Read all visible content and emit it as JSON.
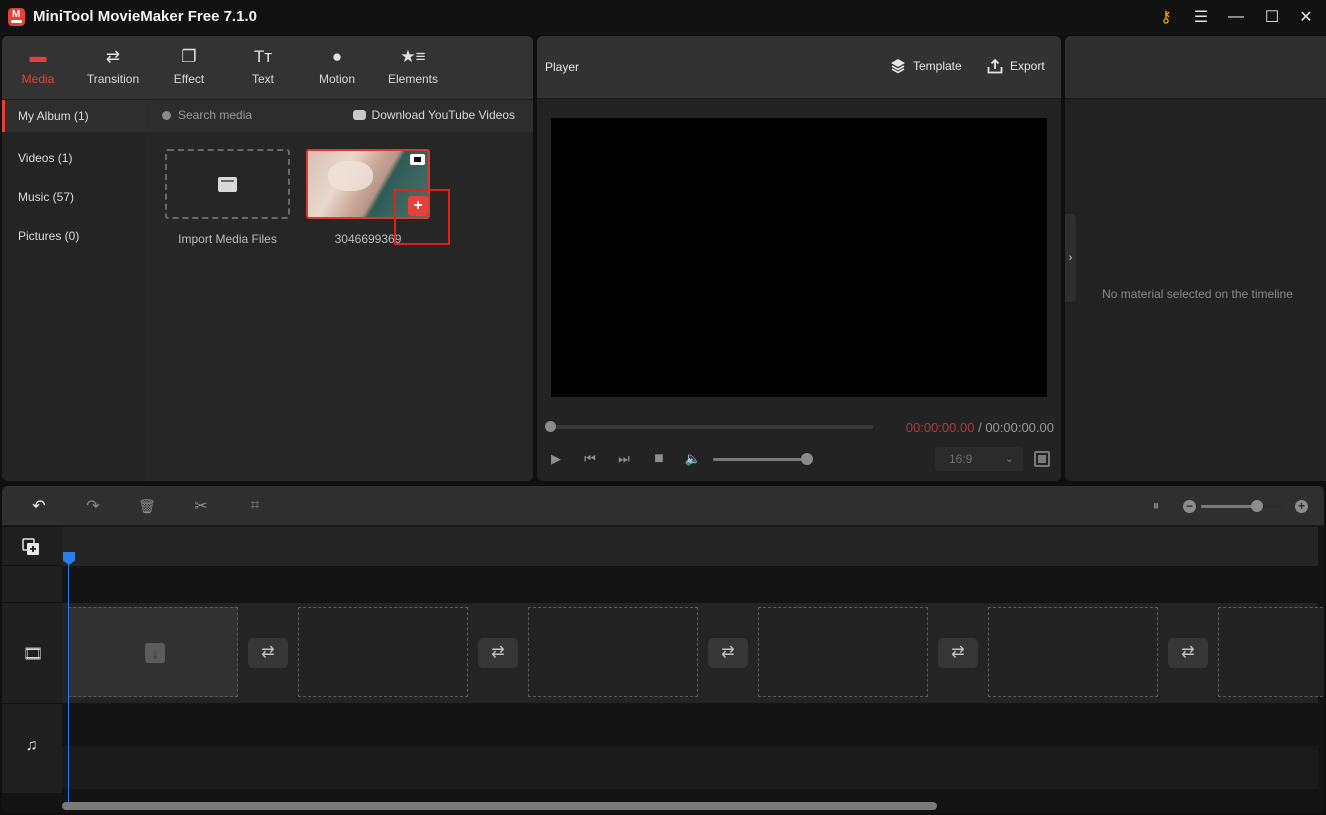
{
  "window": {
    "title": "MiniTool MovieMaker Free 7.1.0",
    "logo_glyph": "M",
    "controls": {
      "key": "⚷",
      "menu": "☰",
      "minimize": "—",
      "maximize": "☐",
      "close": "✕"
    }
  },
  "toolbar": {
    "tabs": [
      {
        "label": "Media",
        "icon": "▬",
        "active": true
      },
      {
        "label": "Transition",
        "icon": "⇄"
      },
      {
        "label": "Effect",
        "icon": "❐"
      },
      {
        "label": "Text",
        "icon": "Tт"
      },
      {
        "label": "Motion",
        "icon": "●"
      },
      {
        "label": "Elements",
        "icon": "★≡"
      }
    ]
  },
  "sidebar": {
    "items": [
      {
        "label": "My Album (1)",
        "active": true
      },
      {
        "label": "Videos (1)"
      },
      {
        "label": "Music (57)"
      },
      {
        "label": "Pictures (0)"
      }
    ]
  },
  "media": {
    "search_placeholder": "Search media",
    "download_label": "Download YouTube Videos",
    "import_label": "Import Media Files",
    "items": [
      {
        "name": "3046699369",
        "type": "video",
        "add_glyph": "+"
      }
    ]
  },
  "player": {
    "title": "Player",
    "template_label": "Template",
    "export_label": "Export",
    "time_current": "00:00:00.00",
    "time_separator": " / ",
    "time_total": "00:00:00.00",
    "progress": 0,
    "volume": 1.0,
    "aspect_ratio": "16:9",
    "controls": {
      "play": "▶",
      "prev": "⏮",
      "next": "⏭",
      "stop": "■",
      "volume": "🔈",
      "chevron": "⌄"
    }
  },
  "properties": {
    "empty_message": "No material selected on the timeline",
    "collapse_glyph": "›"
  },
  "timeline": {
    "toolbar": {
      "undo": "↶",
      "redo": "↷",
      "delete": "🗑",
      "split": "✂",
      "crop": "⌗",
      "fit": "⏸"
    },
    "zoom_level": 0.82,
    "zoom_minus": "−",
    "zoom_plus": "+",
    "video_slots": 6,
    "transition_glyph": "⇄",
    "import_slot_glyph": "↓",
    "track_icons": {
      "add_track": "⊞",
      "video": "🎞",
      "audio": "♫"
    }
  },
  "colors": {
    "accent": "#e5403a",
    "playhead": "#2b7de9",
    "time_current": "#b23a36",
    "key": "#f0b100"
  }
}
